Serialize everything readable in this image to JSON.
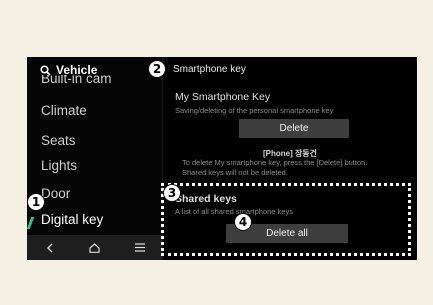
{
  "sidebar": {
    "title": "Vehicle",
    "items": [
      {
        "label": "Built-in cam"
      },
      {
        "label": "Climate"
      },
      {
        "label": "Seats"
      },
      {
        "label": "Lights"
      },
      {
        "label": "Door"
      },
      {
        "label": "Digital key"
      }
    ]
  },
  "navbar": {
    "back_icon": "back-icon",
    "home_icon": "home-icon",
    "menu_icon": "menu-icon"
  },
  "main": {
    "header_title": "Smartphone key",
    "my_key": {
      "title": "My Smartphone Key",
      "subtitle": "Saving/deleting of the personal smartphone key",
      "delete_label": "Delete",
      "phone_name": "[Phone] 장동건",
      "note_line1": "To delete My smartphone key, press the [Delete] button.",
      "note_line2": "Shared keys will not be deleted."
    },
    "shared_keys": {
      "title": "Shared keys",
      "subtitle": "A list of all shared smartphone keys",
      "delete_all_label": "Delete all"
    }
  },
  "markers": [
    "1",
    "2",
    "3",
    "4"
  ],
  "colors": {
    "background": "#f4f0e4",
    "screen": "#000000",
    "active_accent": "#3bbf84",
    "button": "#3e3e3e"
  }
}
